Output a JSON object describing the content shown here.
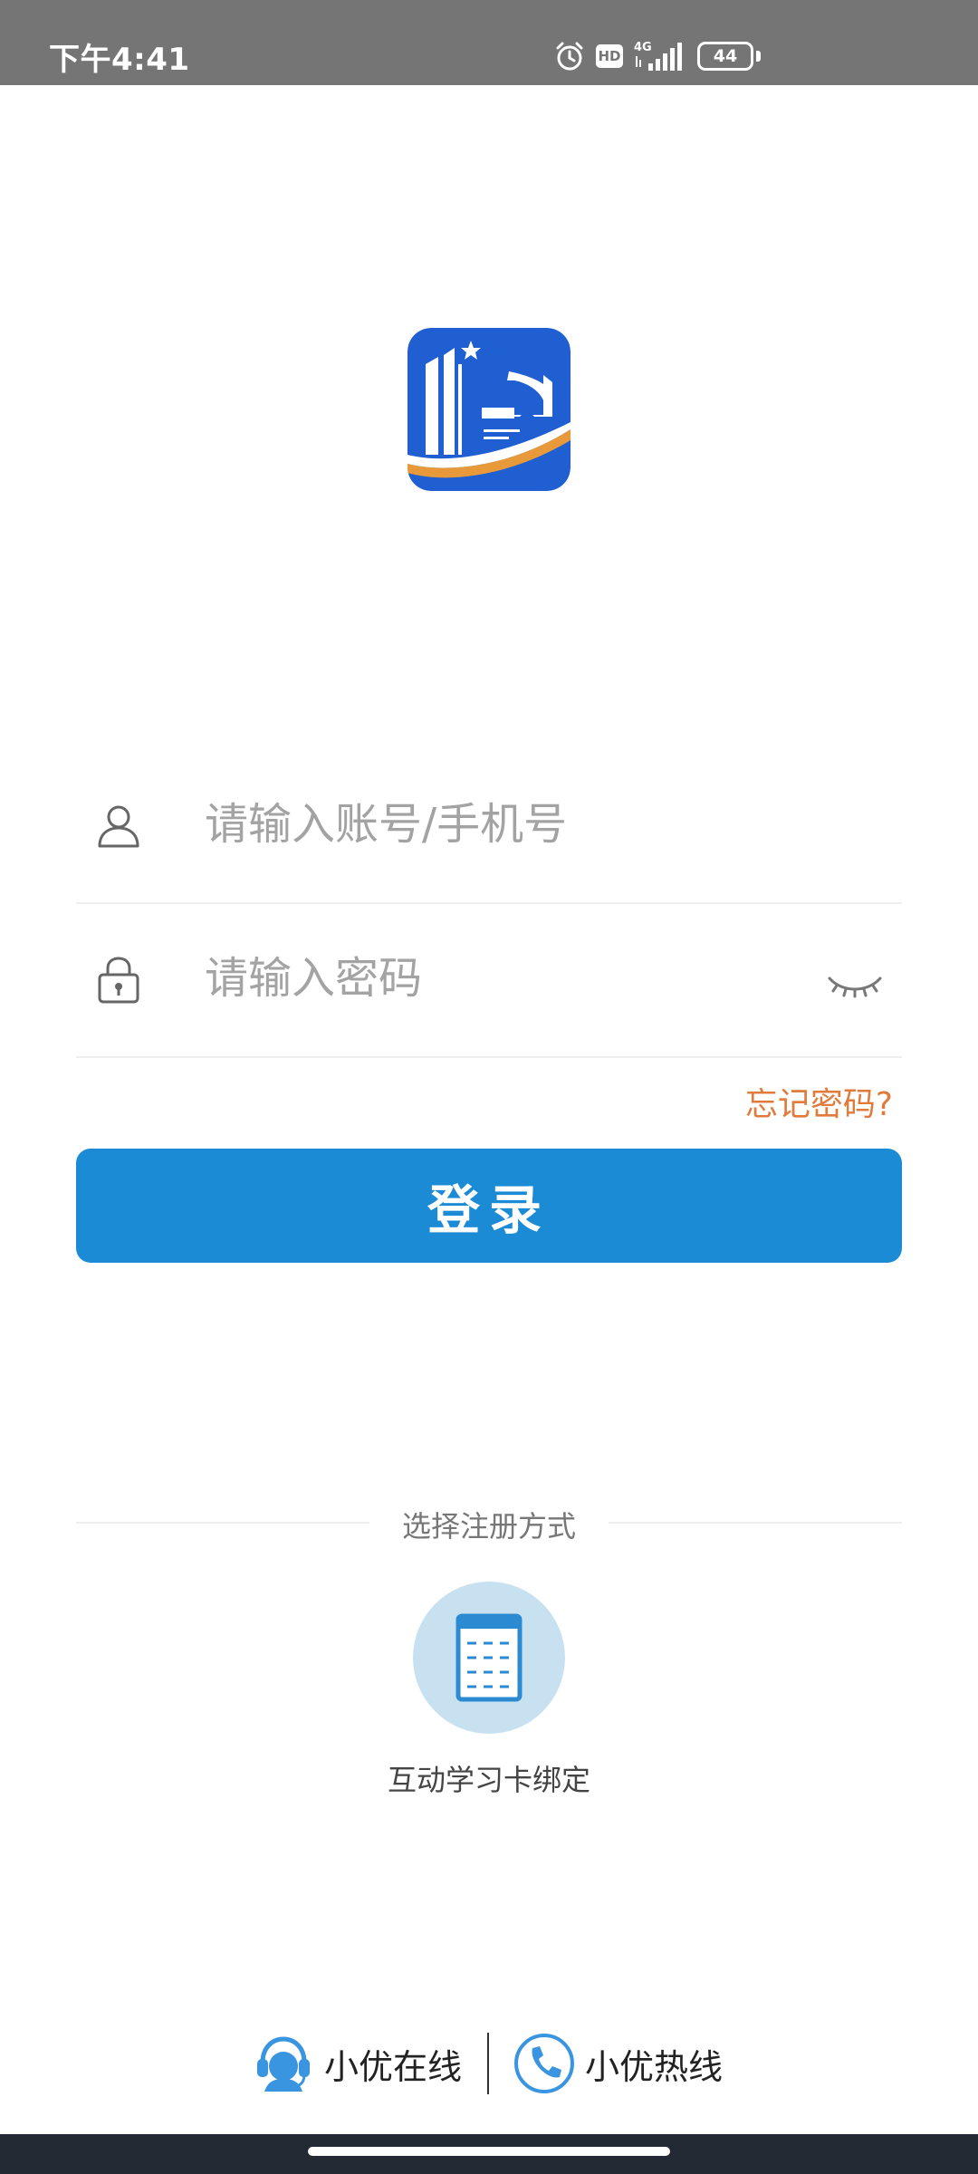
{
  "status_bar": {
    "time": "下午4:41",
    "network": "4G",
    "hd_label": "HD",
    "battery": "44",
    "icons": [
      "alarm-icon",
      "hd-icon",
      "signal-icon",
      "battery-icon"
    ]
  },
  "logo": {
    "icon": "app-logo",
    "colors": {
      "blue": "#1f5fd1",
      "orange": "#e89a3a"
    }
  },
  "login_form": {
    "account_placeholder": "请输入账号/手机号",
    "password_placeholder": "请输入密码",
    "forgot_password": "忘记密码?",
    "login_button": "登录",
    "icons": {
      "account": "user-icon",
      "password": "lock-icon",
      "toggle": "eye-closed-icon"
    }
  },
  "register": {
    "section_title": "选择注册方式",
    "options": [
      {
        "label": "互动学习卡绑定",
        "icon": "calculator-card-icon"
      }
    ]
  },
  "support": {
    "online_label": "小优在线",
    "online_icon": "headset-agent-icon",
    "hotline_label": "小优热线",
    "hotline_icon": "phone-icon"
  },
  "colors": {
    "primary": "#1c8bd6",
    "link_orange": "#e07b3c",
    "status_bar": "#757575",
    "nav_bar": "#242a33"
  }
}
